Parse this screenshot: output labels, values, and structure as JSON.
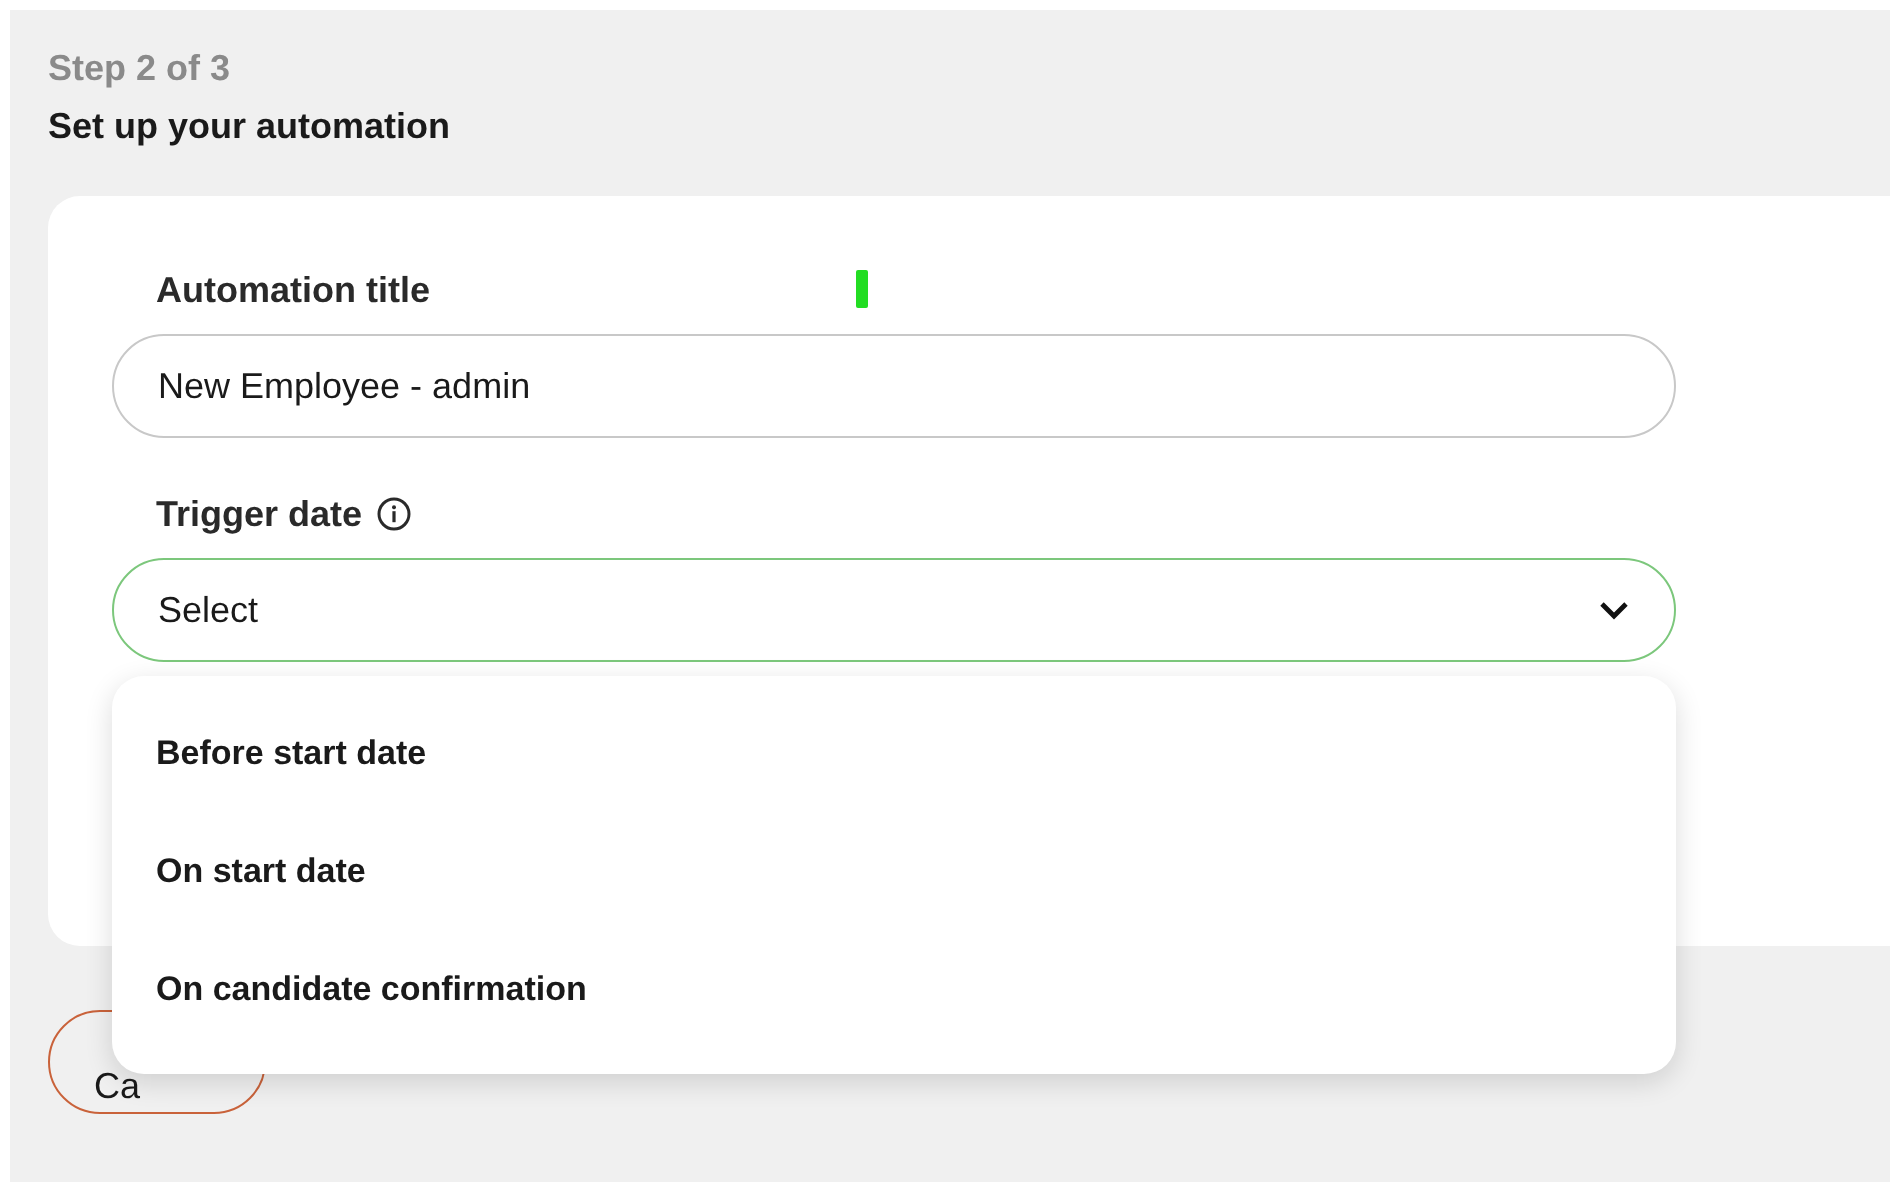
{
  "header": {
    "step": "Step 2 of 3",
    "title": "Set up your automation"
  },
  "form": {
    "title_label": "Automation title",
    "title_value": "New Employee - admin",
    "trigger_label": "Trigger date",
    "trigger_placeholder": "Select",
    "trigger_open": true,
    "options": [
      {
        "label": "Before start date",
        "selected": false
      },
      {
        "label": "On start date",
        "selected": false
      },
      {
        "label": "On candidate confirmation",
        "selected": false
      }
    ]
  },
  "cancel_button": "Ca"
}
